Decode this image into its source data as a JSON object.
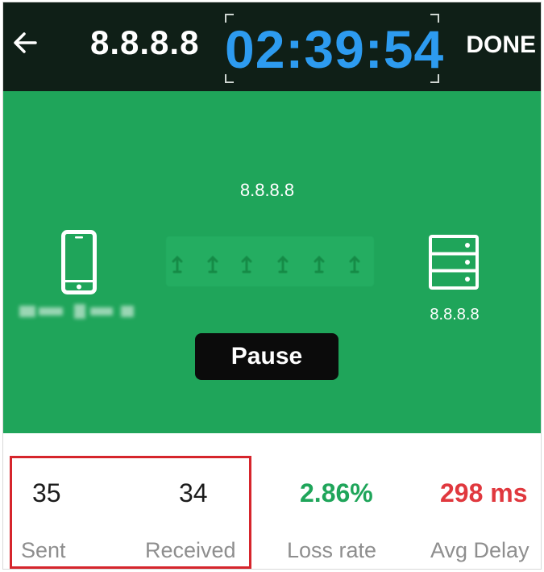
{
  "header": {
    "back_icon": "arrow-left-icon",
    "host": "8.8.8.8",
    "timer": "02:39:54",
    "done_label": "DONE",
    "background_color": "#0f1f17",
    "timer_color": "#2d9bf0"
  },
  "stage": {
    "background_color": "#1fa55a",
    "route_host": "8.8.8.8",
    "device_icon": "smartphone-icon",
    "server_icon": "server-icon",
    "server_host": "8.8.8.8",
    "pause_label": "Pause"
  },
  "stats": {
    "sent": {
      "value": "35",
      "label": "Sent"
    },
    "received": {
      "value": "34",
      "label": "Received"
    },
    "loss_rate": {
      "value": "2.86%",
      "label": "Loss rate",
      "color": "#1fa55a"
    },
    "avg_delay": {
      "value": "298 ms",
      "label": "Avg Delay",
      "color": "#e0383e"
    },
    "highlight_color": "#d6252c"
  }
}
